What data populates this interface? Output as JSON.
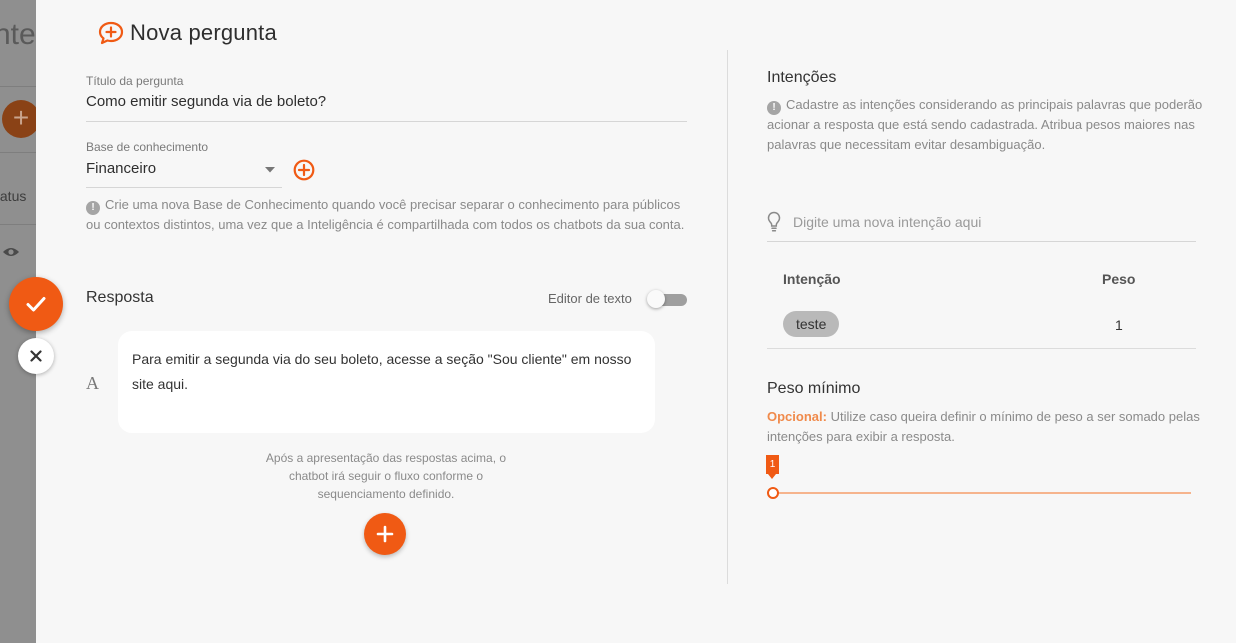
{
  "background": {
    "title_fragment": "nte",
    "status_fragment": "tatus"
  },
  "header": {
    "title": "Nova pergunta"
  },
  "form": {
    "question_title": {
      "label": "Título da pergunta",
      "value": "Como emitir segunda via de boleto?"
    },
    "knowledge_base": {
      "label": "Base de conhecimento",
      "value": "Financeiro",
      "info": "Crie uma nova Base de Conhecimento quando você precisar separar o conhecimento para públicos ou contextos distintos, uma vez que a Inteligência é compartilhada com todos os chatbots da sua conta."
    },
    "response": {
      "label": "Resposta",
      "editor_toggle_label": "Editor de texto",
      "editor_toggle_on": false,
      "text_type_glyph": "A",
      "answer_text": "Para emitir a segunda via do seu boleto, acesse a seção \"Sou cliente\" em nosso site aqui.",
      "footer_note": "Após a apresentação das respostas acima, o chatbot irá seguir o fluxo conforme o sequenciamento definido."
    }
  },
  "intents": {
    "title": "Intenções",
    "info": "Cadastre as intenções considerando as principais palavras que poderão acionar a resposta que está sendo cadastrada. Atribua pesos maiores nas palavras que necessitam evitar desambiguação.",
    "input_placeholder": "Digite uma nova intenção aqui",
    "table": {
      "headers": [
        "Intenção",
        "Peso"
      ],
      "rows": [
        {
          "intent": "teste",
          "weight": "1"
        }
      ]
    }
  },
  "min_weight": {
    "title": "Peso mínimo",
    "optional_label": "Opcional:",
    "description": "Utilize caso queira definir o mínimo de peso a ser somado pelas intenções para exibir a resposta.",
    "slider_value": "1"
  },
  "colors": {
    "accent": "#f05a14",
    "accent_light": "#f6b48d",
    "optional_text": "#f08a4b"
  },
  "icons": {
    "header": "chat-plus-icon",
    "add_knowledge_base": "add-circle-icon",
    "info": "info-icon",
    "intent_input": "lightbulb-icon",
    "confirm": "check-icon",
    "close": "close-icon",
    "add_answer": "plus-icon",
    "background_eye": "eye-icon"
  }
}
